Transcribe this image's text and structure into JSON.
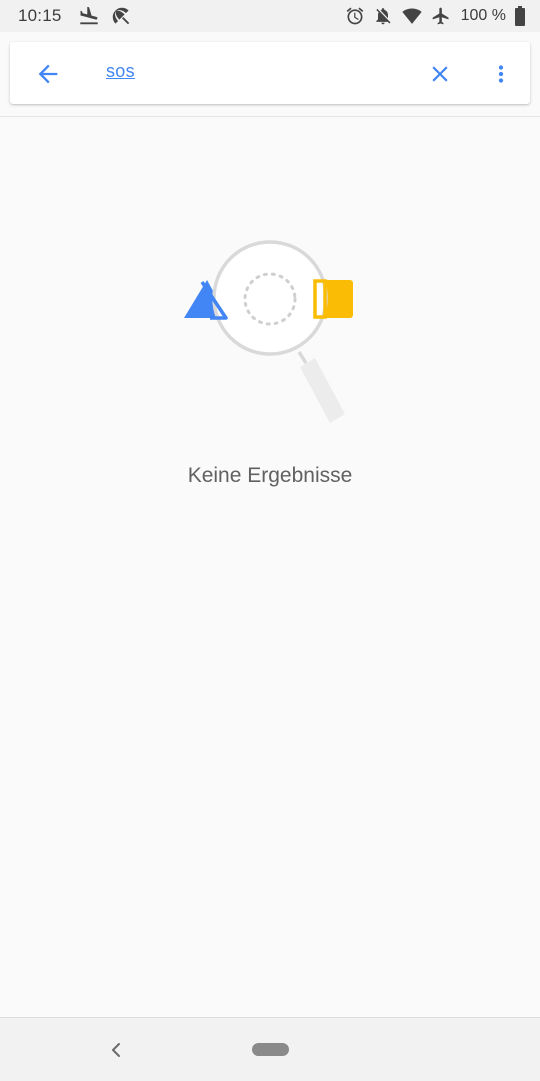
{
  "status_bar": {
    "time": "10:15",
    "left_icons": [
      "flight-land-icon",
      "beach-icon"
    ],
    "right_icons": [
      "alarm-icon",
      "notifications-off-icon",
      "wifi-icon",
      "airplane-mode-icon"
    ],
    "battery_text": "100 %"
  },
  "search": {
    "query": "sos",
    "back_icon": "arrow-back-icon",
    "clear_icon": "close-icon",
    "more_icon": "more-vert-icon"
  },
  "empty_state": {
    "message": "Keine Ergebnisse",
    "illustration_colors": {
      "triangle": "#4285f4",
      "square": "#fbbc05",
      "magnifier": "#d9d9d9"
    }
  },
  "colors": {
    "accent": "#4285f4",
    "background": "#fafafa"
  }
}
